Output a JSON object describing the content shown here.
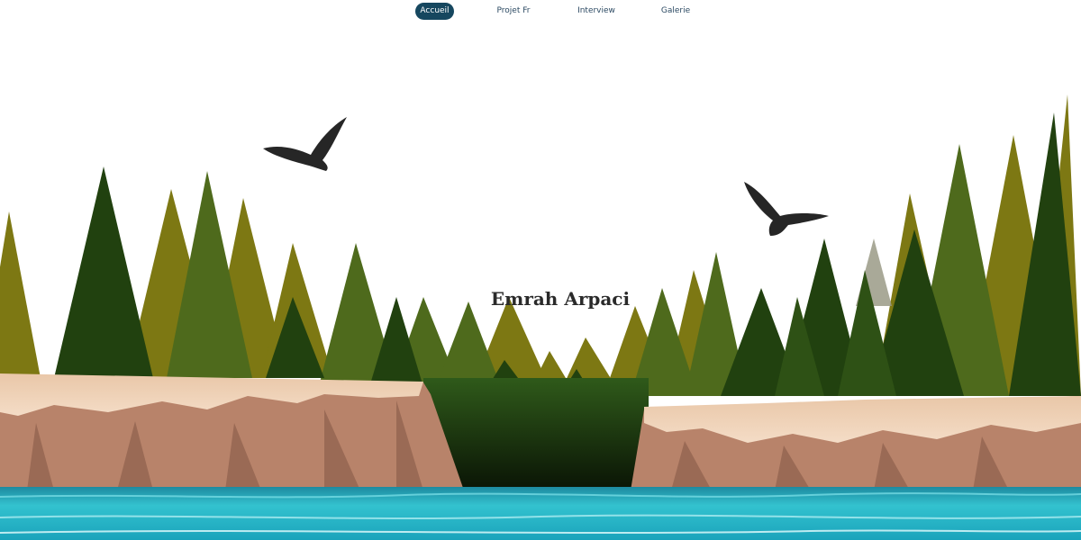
{
  "nav": {
    "items": [
      {
        "label": "Accueil",
        "active": true
      },
      {
        "label": "Projet Fr",
        "active": false
      },
      {
        "label": "Interview",
        "active": false
      },
      {
        "label": "Galerie",
        "active": false
      }
    ]
  },
  "hero": {
    "title": "Emrah Arpaci",
    "illustration": "forest-cliffs-river-with-eagles"
  },
  "colors": {
    "nav_active_bg": "#16475f",
    "nav_text": "#2c4a63",
    "water": "#2ab8c8",
    "cliff": "#c08f77",
    "forest_dark": "#1f3a12",
    "forest_olive": "#7e7a12"
  }
}
